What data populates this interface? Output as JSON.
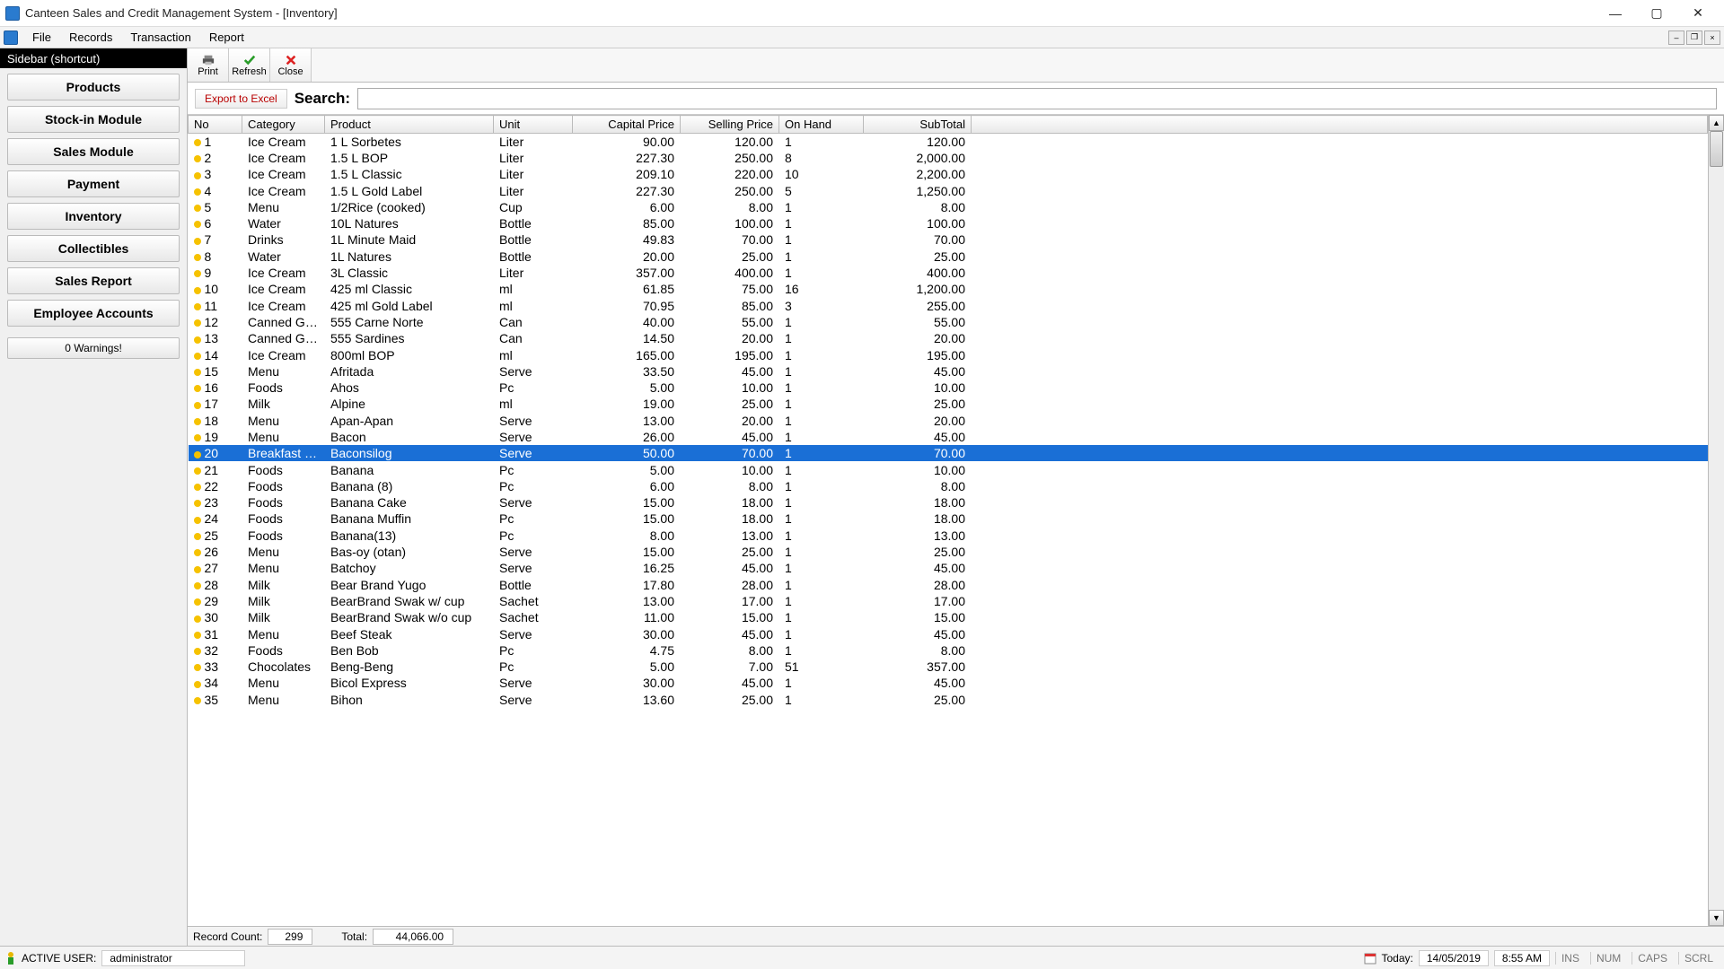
{
  "window": {
    "title": "Canteen Sales and Credit Management System - [Inventory]"
  },
  "menu": {
    "items": [
      "File",
      "Records",
      "Transaction",
      "Report"
    ]
  },
  "sidebar": {
    "header": "Sidebar (shortcut)",
    "buttons": [
      "Products",
      "Stock-in Module",
      "Sales Module",
      "Payment",
      "Inventory",
      "Collectibles",
      "Sales Report",
      "Employee Accounts"
    ],
    "warnings": "0 Warnings!"
  },
  "toolbar": {
    "print": "Print",
    "refresh": "Refresh",
    "close": "Close"
  },
  "search": {
    "export": "Export to Excel",
    "label": "Search:",
    "value": ""
  },
  "grid": {
    "headers": [
      "No",
      "Category",
      "Product",
      "Unit",
      "Capital Price",
      "Selling Price",
      "On Hand",
      "SubTotal"
    ],
    "selected_index": 19,
    "rows": [
      {
        "no": "1",
        "cat": "Ice Cream",
        "prod": "1 L Sorbetes",
        "unit": "Liter",
        "cap": "90.00",
        "sell": "120.00",
        "on": "1",
        "sub": "120.00"
      },
      {
        "no": "2",
        "cat": "Ice Cream",
        "prod": "1.5 L BOP",
        "unit": "Liter",
        "cap": "227.30",
        "sell": "250.00",
        "on": "8",
        "sub": "2,000.00"
      },
      {
        "no": "3",
        "cat": "Ice Cream",
        "prod": "1.5 L Classic",
        "unit": "Liter",
        "cap": "209.10",
        "sell": "220.00",
        "on": "10",
        "sub": "2,200.00"
      },
      {
        "no": "4",
        "cat": "Ice Cream",
        "prod": "1.5 L Gold Label",
        "unit": "Liter",
        "cap": "227.30",
        "sell": "250.00",
        "on": "5",
        "sub": "1,250.00"
      },
      {
        "no": "5",
        "cat": "Menu",
        "prod": "1/2Rice (cooked)",
        "unit": "Cup",
        "cap": "6.00",
        "sell": "8.00",
        "on": "1",
        "sub": "8.00"
      },
      {
        "no": "6",
        "cat": "Water",
        "prod": "10L Natures",
        "unit": "Bottle",
        "cap": "85.00",
        "sell": "100.00",
        "on": "1",
        "sub": "100.00"
      },
      {
        "no": "7",
        "cat": "Drinks",
        "prod": "1L Minute Maid",
        "unit": "Bottle",
        "cap": "49.83",
        "sell": "70.00",
        "on": "1",
        "sub": "70.00"
      },
      {
        "no": "8",
        "cat": "Water",
        "prod": "1L Natures",
        "unit": "Bottle",
        "cap": "20.00",
        "sell": "25.00",
        "on": "1",
        "sub": "25.00"
      },
      {
        "no": "9",
        "cat": "Ice Cream",
        "prod": "3L Classic",
        "unit": "Liter",
        "cap": "357.00",
        "sell": "400.00",
        "on": "1",
        "sub": "400.00"
      },
      {
        "no": "10",
        "cat": "Ice Cream",
        "prod": "425 ml Classic",
        "unit": "ml",
        "cap": "61.85",
        "sell": "75.00",
        "on": "16",
        "sub": "1,200.00"
      },
      {
        "no": "11",
        "cat": "Ice Cream",
        "prod": "425 ml Gold Label",
        "unit": "ml",
        "cap": "70.95",
        "sell": "85.00",
        "on": "3",
        "sub": "255.00"
      },
      {
        "no": "12",
        "cat": "Canned G…",
        "prod": "555 Carne Norte",
        "unit": "Can",
        "cap": "40.00",
        "sell": "55.00",
        "on": "1",
        "sub": "55.00"
      },
      {
        "no": "13",
        "cat": "Canned G…",
        "prod": "555 Sardines",
        "unit": "Can",
        "cap": "14.50",
        "sell": "20.00",
        "on": "1",
        "sub": "20.00"
      },
      {
        "no": "14",
        "cat": "Ice Cream",
        "prod": "800ml BOP",
        "unit": "ml",
        "cap": "165.00",
        "sell": "195.00",
        "on": "1",
        "sub": "195.00"
      },
      {
        "no": "15",
        "cat": "Menu",
        "prod": "Afritada",
        "unit": "Serve",
        "cap": "33.50",
        "sell": "45.00",
        "on": "1",
        "sub": "45.00"
      },
      {
        "no": "16",
        "cat": "Foods",
        "prod": "Ahos",
        "unit": "Pc",
        "cap": "5.00",
        "sell": "10.00",
        "on": "1",
        "sub": "10.00"
      },
      {
        "no": "17",
        "cat": "Milk",
        "prod": "Alpine",
        "unit": "ml",
        "cap": "19.00",
        "sell": "25.00",
        "on": "1",
        "sub": "25.00"
      },
      {
        "no": "18",
        "cat": "Menu",
        "prod": "Apan-Apan",
        "unit": "Serve",
        "cap": "13.00",
        "sell": "20.00",
        "on": "1",
        "sub": "20.00"
      },
      {
        "no": "19",
        "cat": "Menu",
        "prod": "Bacon",
        "unit": "Serve",
        "cap": "26.00",
        "sell": "45.00",
        "on": "1",
        "sub": "45.00"
      },
      {
        "no": "20",
        "cat": "Breakfast …",
        "prod": "Baconsilog",
        "unit": "Serve",
        "cap": "50.00",
        "sell": "70.00",
        "on": "1",
        "sub": "70.00"
      },
      {
        "no": "21",
        "cat": "Foods",
        "prod": "Banana",
        "unit": "Pc",
        "cap": "5.00",
        "sell": "10.00",
        "on": "1",
        "sub": "10.00"
      },
      {
        "no": "22",
        "cat": "Foods",
        "prod": "Banana (8)",
        "unit": "Pc",
        "cap": "6.00",
        "sell": "8.00",
        "on": "1",
        "sub": "8.00"
      },
      {
        "no": "23",
        "cat": "Foods",
        "prod": "Banana Cake",
        "unit": "Serve",
        "cap": "15.00",
        "sell": "18.00",
        "on": "1",
        "sub": "18.00"
      },
      {
        "no": "24",
        "cat": "Foods",
        "prod": "Banana Muffin",
        "unit": "Pc",
        "cap": "15.00",
        "sell": "18.00",
        "on": "1",
        "sub": "18.00"
      },
      {
        "no": "25",
        "cat": "Foods",
        "prod": "Banana(13)",
        "unit": "Pc",
        "cap": "8.00",
        "sell": "13.00",
        "on": "1",
        "sub": "13.00"
      },
      {
        "no": "26",
        "cat": "Menu",
        "prod": "Bas-oy (otan)",
        "unit": "Serve",
        "cap": "15.00",
        "sell": "25.00",
        "on": "1",
        "sub": "25.00"
      },
      {
        "no": "27",
        "cat": "Menu",
        "prod": "Batchoy",
        "unit": "Serve",
        "cap": "16.25",
        "sell": "45.00",
        "on": "1",
        "sub": "45.00"
      },
      {
        "no": "28",
        "cat": "Milk",
        "prod": "Bear Brand Yugo",
        "unit": "Bottle",
        "cap": "17.80",
        "sell": "28.00",
        "on": "1",
        "sub": "28.00"
      },
      {
        "no": "29",
        "cat": "Milk",
        "prod": "BearBrand Swak w/ cup",
        "unit": "Sachet",
        "cap": "13.00",
        "sell": "17.00",
        "on": "1",
        "sub": "17.00"
      },
      {
        "no": "30",
        "cat": "Milk",
        "prod": "BearBrand Swak w/o cup",
        "unit": "Sachet",
        "cap": "11.00",
        "sell": "15.00",
        "on": "1",
        "sub": "15.00"
      },
      {
        "no": "31",
        "cat": "Menu",
        "prod": "Beef Steak",
        "unit": "Serve",
        "cap": "30.00",
        "sell": "45.00",
        "on": "1",
        "sub": "45.00"
      },
      {
        "no": "32",
        "cat": "Foods",
        "prod": "Ben Bob",
        "unit": "Pc",
        "cap": "4.75",
        "sell": "8.00",
        "on": "1",
        "sub": "8.00"
      },
      {
        "no": "33",
        "cat": "Chocolates",
        "prod": "Beng-Beng",
        "unit": "Pc",
        "cap": "5.00",
        "sell": "7.00",
        "on": "51",
        "sub": "357.00"
      },
      {
        "no": "34",
        "cat": "Menu",
        "prod": "Bicol Express",
        "unit": "Serve",
        "cap": "30.00",
        "sell": "45.00",
        "on": "1",
        "sub": "45.00"
      },
      {
        "no": "35",
        "cat": "Menu",
        "prod": "Bihon",
        "unit": "Serve",
        "cap": "13.60",
        "sell": "25.00",
        "on": "1",
        "sub": "25.00"
      }
    ],
    "footer": {
      "count_label": "Record Count:",
      "count": "299",
      "total_label": "Total:",
      "total": "44,066.00"
    }
  },
  "status": {
    "active_user_label": "ACTIVE USER:",
    "active_user": "administrator",
    "today_label": "Today:",
    "date": "14/05/2019",
    "time": "8:55 AM",
    "ins": "INS",
    "num": "NUM",
    "caps": "CAPS",
    "scrl": "SCRL"
  }
}
